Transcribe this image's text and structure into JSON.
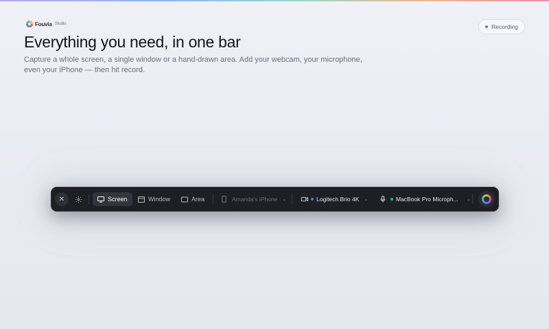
{
  "brand": {
    "name": "Fouvia",
    "sub": "Studio"
  },
  "hero": {
    "title": "Everything you need, in one bar",
    "description": "Capture a whole screen, a single window or a hand-drawn area. Add your webcam, your microphone, even your iPhone — then hit record."
  },
  "status": {
    "label": "Recording",
    "dot_color": "#3b82f6"
  },
  "toolbar": {
    "close_icon": "close-icon",
    "settings_icon": "gear-icon",
    "modes": [
      {
        "label": "Screen",
        "icon": "monitor-icon",
        "active": true
      },
      {
        "label": "Window",
        "icon": "window-icon",
        "active": false
      },
      {
        "label": "Area",
        "icon": "area-icon",
        "active": false
      }
    ],
    "iphone": {
      "label": "Amanda's iPhone",
      "icon": "phone-icon",
      "enabled": false
    },
    "camera": {
      "label": "Logitech Brio 4K",
      "icon": "camera-icon",
      "dot_color": "#3b82f6"
    },
    "microphone": {
      "label": "MacBook Pro Microph...",
      "icon": "mic-icon",
      "dot_color": "#22c55e"
    },
    "record_icon": "record-icon"
  }
}
